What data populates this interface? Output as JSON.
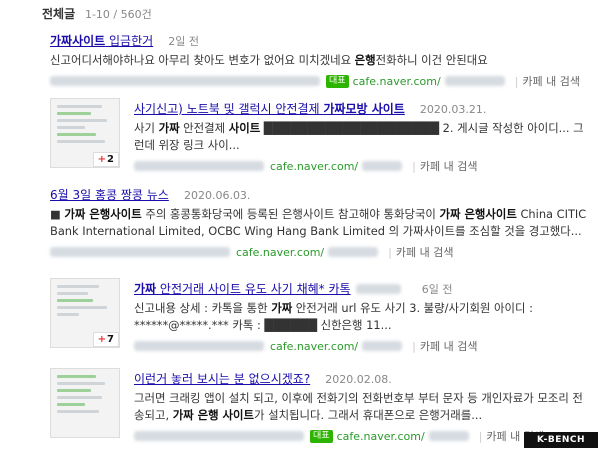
{
  "header": {
    "title": "전체글",
    "count": "1-10 / 560건"
  },
  "results": [
    {
      "title_pre": "",
      "title_bold": "가짜사이트",
      "title_post": " 입금한거",
      "date": "2일 전",
      "snippet_html": "신고어디서해야하나요 아무리 찾아도 변호가 없어요 미치겠네요 <b>은행</b>전화하니 이건 안된대요",
      "badge": "대표",
      "url": "cafe.naver.com/",
      "cafe_search": "카페 내 검색"
    },
    {
      "title_pre": "사기신고) 노트북 및 갤럭시 안전결제 ",
      "title_bold": "가짜모방 사이트",
      "title_post": "",
      "date": "2020.03.21.",
      "snippet_html": "사기 <b>가짜</b> 안전결제 <b>사이트</b> ████████████████████ 2. 게시글 작성한 아이디... 그런데 위장 링크 사이...",
      "url": "cafe.naver.com/",
      "cafe_search": "카페 내 검색",
      "thumb_count": "2"
    },
    {
      "title_pre": "6월 3일 홍콩 짱콩 뉴스",
      "title_bold": "",
      "title_post": "",
      "date": "2020.06.03.",
      "snippet_html": "■ <b>가짜 은행사이트</b> 주의 홍콩통화당국에 등록된 은행사이트 참고해야 통화당국이 <b>가짜 은행사이트</b> China CITIC Bank International Limited, OCBC Wing Hang Bank Limited 의 가짜사이트를 조심할 것을 경고했다...",
      "url": "cafe.naver.com/",
      "cafe_search": "카페 내 검색"
    },
    {
      "title_pre": "",
      "title_bold": "가짜",
      "title_post": " 안전거래 사이트 유도 사기 채혜* 카톡",
      "date": "6일 전",
      "snippet_html": "신고내용 상세 : 카톡을 통한 <b>가짜</b> 안전거래 url 유도 사기 3. 불량/사기회원 아이디 : ******@*****.*** 카톡 : ██████ 신한은행 11...",
      "url": "cafe.naver.com/",
      "cafe_search": "카페 내 검색",
      "thumb_count": "7"
    },
    {
      "title_pre": "이런거 놓러 보시는 분 없으시겠죠?",
      "title_bold": "",
      "title_post": "",
      "date": "2020.02.08.",
      "snippet_html": "그러면 크래킹 앱이 설치 되고, 이후에 전화기의 전화번호부 부터 문자 등 개인자료가 모조리 전송되고, <b>가짜 은행 사이트</b>가 설치됩니다. 그래서 휴대폰으로 은행거래를...",
      "badge": "대표",
      "url": "cafe.naver.com/",
      "cafe_search": "카페 내 검색"
    }
  ],
  "logo": {
    "text": "K-BENCH"
  }
}
